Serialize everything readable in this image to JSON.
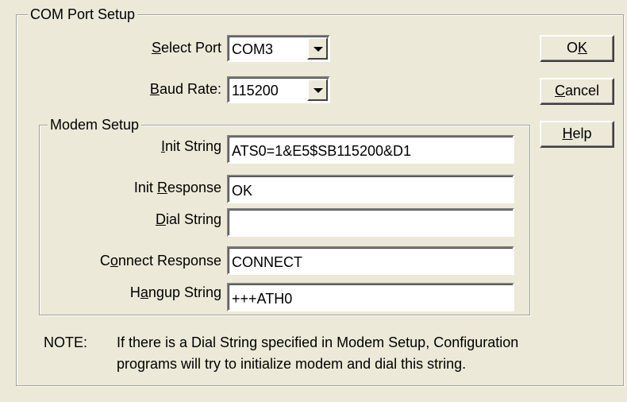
{
  "com_port_group": {
    "title": "COM Port Setup"
  },
  "select_port": {
    "label_accel": "S",
    "label_rest": "elect Port",
    "value": "COM3"
  },
  "baud_rate": {
    "label_accel": "B",
    "label_rest": "aud Rate:",
    "value": "115200"
  },
  "buttons": {
    "ok_pre": "O",
    "ok_accel": "K",
    "cancel_accel": "C",
    "cancel_rest": "ancel",
    "help_accel": "H",
    "help_rest": "elp"
  },
  "modem_group": {
    "title": "Modem Setup"
  },
  "init_string": {
    "label_accel": "I",
    "label_rest": "nit String",
    "value": "ATS0=1&E5$SB115200&D1"
  },
  "init_response": {
    "label_pre": "Init ",
    "label_accel": "R",
    "label_rest": "esponse",
    "value": "OK"
  },
  "dial_string": {
    "label_accel": "D",
    "label_rest": "ial String",
    "value": ""
  },
  "connect_response": {
    "label_pre": "C",
    "label_accel": "o",
    "label_rest": "nnect Response",
    "value": "CONNECT"
  },
  "hangup_string": {
    "label_pre": "H",
    "label_accel": "a",
    "label_rest": "ngup String",
    "value": "+++ATH0"
  },
  "note": {
    "prefix": "NOTE:",
    "line1": "If there is a Dial String specified in Modem Setup, Configuration",
    "line2": "programs will try to initialize modem and dial this string."
  }
}
